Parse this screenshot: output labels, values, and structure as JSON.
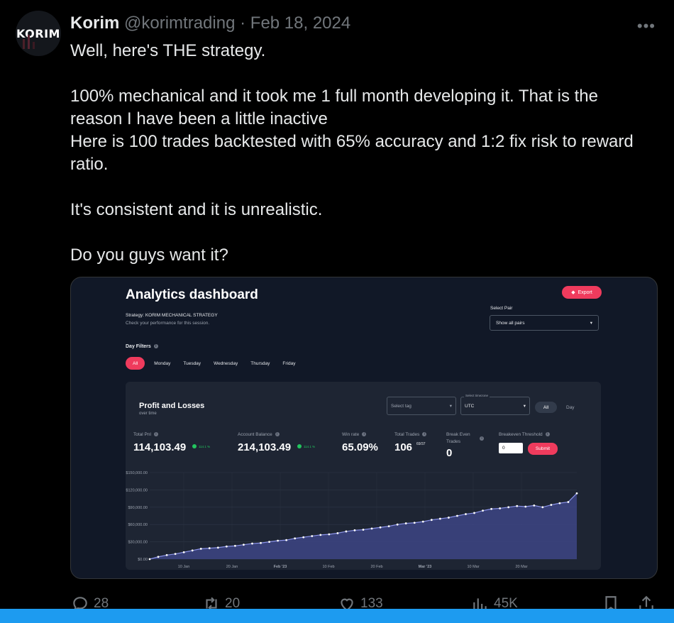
{
  "author": {
    "name": "Korim",
    "handle": "@korimtrading",
    "separator": "·",
    "date": "Feb 18, 2024",
    "avatar_text": "KORIM"
  },
  "more_icon": "more-dots-icon",
  "tweet": {
    "line1": "Well, here's THE strategy.",
    "para2_l1": "100% mechanical and it took me 1 full month developing it. That is the",
    "para2_l2": "reason I have been a little inactive",
    "para2_l3": "Here is 100 trades backtested with 65% accuracy and 1:2 fix risk to reward",
    "para2_l4": "ratio.",
    "para3": "It's consistent and it is unrealistic.",
    "para4": "Do you guys want it?"
  },
  "dashboard": {
    "title": "Analytics dashboard",
    "export_label": "Export",
    "strategy": "Strategy: KORIM MECHANICAL STRATEGY",
    "strategy_sub": "Check your performance for this session.",
    "select_pair_label": "Select Pair",
    "select_pair_value": "Show all pairs",
    "day_filters_label": "Day Filters",
    "days": [
      "All",
      "Monday",
      "Tuesday",
      "Wednesday",
      "Thursday",
      "Friday"
    ],
    "panel": {
      "title": "Profit and Losses",
      "subtitle": "over time",
      "tag_placeholder": "Select tag",
      "timezone_label": "Select timezone",
      "timezone_value": "UTC",
      "range_all": "All",
      "range_day": "Day",
      "total_pnl_label": "Total Pnl",
      "total_pnl_value": "114,103.49",
      "total_pnl_pct": "114.1 %",
      "balance_label": "Account Balance",
      "balance_value": "214,103.49",
      "balance_pct": "114.1 %",
      "winrate_label": "Win rate",
      "winrate_value": "65.09%",
      "trades_label": "Total Trades",
      "trades_value": "106",
      "trades_split": "69/37",
      "breakeven_label_1": "Break Even",
      "breakeven_label_2": "Trades",
      "breakeven_value": "0",
      "threshold_label": "Breakeven Threshold",
      "threshold_input": "0",
      "submit_label": "Submit"
    }
  },
  "chart_data": {
    "type": "area",
    "y_ticks": [
      "$150,000.00",
      "$120,000.00",
      "$90,000.00",
      "$60,000.00",
      "$30,000.00",
      "$0.00"
    ],
    "x_ticks": [
      "10 Jan",
      "20 Jan",
      "Feb '23",
      "10 Feb",
      "20 Feb",
      "Mar '23",
      "10 Mar",
      "20 Mar"
    ],
    "ylim": [
      0,
      150000
    ],
    "x": [
      0,
      2,
      4,
      6,
      8,
      10,
      12,
      14,
      16,
      18,
      20,
      22,
      24,
      26,
      28,
      30,
      32,
      34,
      36,
      38,
      40,
      42,
      44,
      46,
      48,
      50,
      52,
      54,
      56,
      58,
      60,
      62,
      64,
      66,
      68,
      70,
      72,
      74,
      76,
      78,
      80,
      82,
      84,
      86,
      88,
      90,
      92,
      94,
      96,
      98,
      100
    ],
    "values": [
      0,
      4000,
      7000,
      9000,
      12000,
      15000,
      18000,
      19000,
      20000,
      22000,
      23000,
      25000,
      27000,
      28000,
      30000,
      32000,
      33000,
      36000,
      38000,
      40000,
      42000,
      43000,
      45000,
      48000,
      50000,
      51000,
      53000,
      55000,
      57000,
      60000,
      62000,
      63000,
      65000,
      68000,
      70000,
      72000,
      75000,
      78000,
      80000,
      84000,
      87000,
      88000,
      90000,
      92000,
      91000,
      93000,
      90000,
      94000,
      97000,
      99000,
      114000
    ],
    "grid": true,
    "colors": {
      "line": "#8b93e8",
      "fill": "#3d4585",
      "points": "#ffffff"
    }
  },
  "actions": {
    "reply_count": "28",
    "retweet_count": "20",
    "like_count": "133",
    "views_count": "45K"
  }
}
